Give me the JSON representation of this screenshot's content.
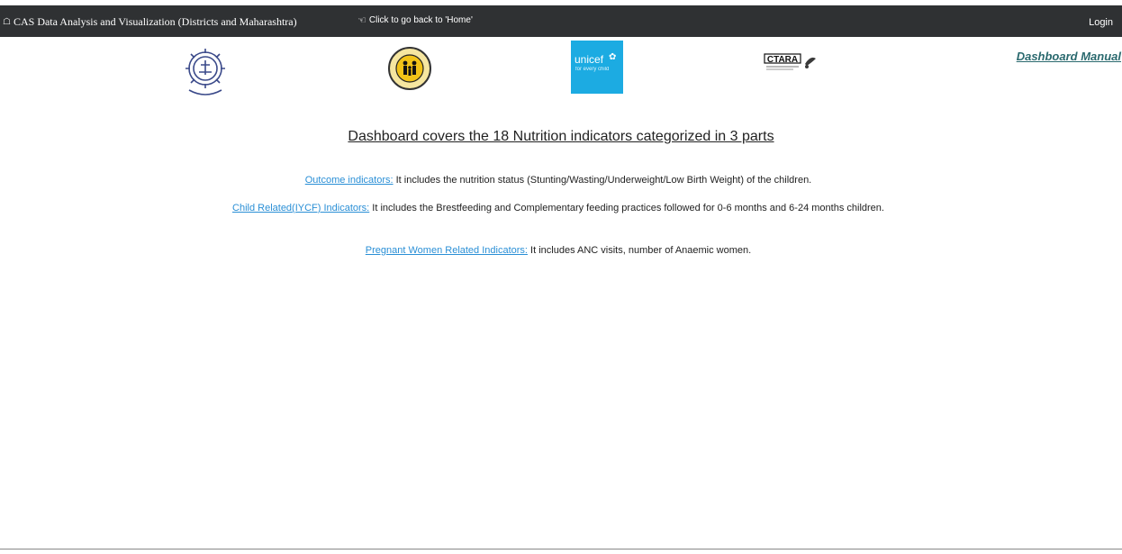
{
  "navbar": {
    "brand_icon": "home-icon",
    "brand_text": "CAS Data Analysis and Visualization (Districts and Maharashtra)",
    "back_icon": "hand-pointer-icon",
    "back_text": "Click to go back to 'Home'",
    "login": "Login",
    "bg_color": "#2f3133"
  },
  "logos": {
    "unicef_name": "unicef",
    "unicef_tagline": "for every child",
    "ctara_text": "CTARA"
  },
  "manual_link": "Dashboard Manual",
  "heading": "Dashboard covers the 18 Nutrition indicators categorized in 3 parts",
  "sections": [
    {
      "link": "Outcome indicators:",
      "text": " It includes the nutrition status (Stunting/Wasting/Underweight/Low Birth Weight) of the children."
    },
    {
      "link": "Child Related(IYCF) Indicators:",
      "text": " It includes the Brestfeeding and Complementary feeding practices followed for 0-6 months and 6-24 months children."
    },
    {
      "link": "Pregnant Women Related Indicators:",
      "text": " It includes ANC visits, number of Anaemic women."
    }
  ],
  "colors": {
    "link": "#2a8fd6",
    "unicef_blue": "#1cabe2",
    "manual_link": "#2b6a6f"
  }
}
